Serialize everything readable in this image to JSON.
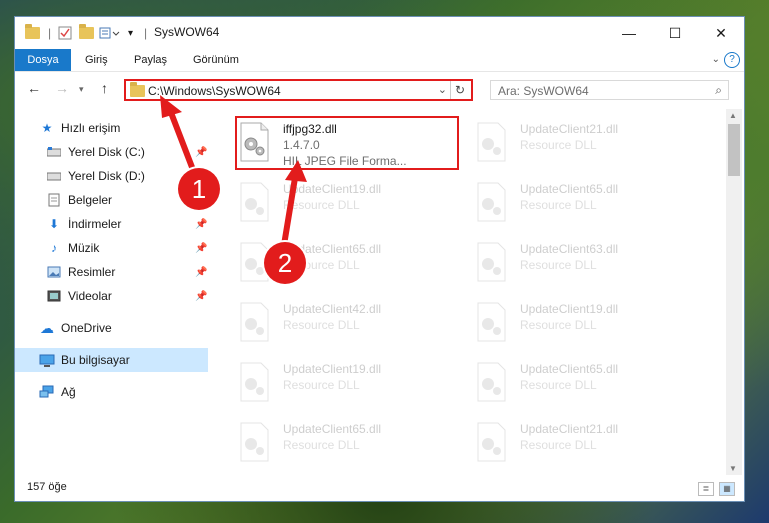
{
  "window": {
    "title": "SysWOW64"
  },
  "ribbon": {
    "tabs": [
      "Dosya",
      "Giriş",
      "Paylaş",
      "Görünüm"
    ]
  },
  "address": {
    "path": "C:\\Windows\\SysWOW64"
  },
  "search": {
    "placeholder": "Ara: SysWOW64"
  },
  "sidebar": {
    "items": [
      {
        "label": "Hızlı erişim",
        "icon": "star-icon"
      },
      {
        "label": "Yerel Disk (C:)",
        "icon": "drive-icon"
      },
      {
        "label": "Yerel Disk (D:)",
        "icon": "drive-icon"
      },
      {
        "label": "Belgeler",
        "icon": "documents-icon"
      },
      {
        "label": "İndirmeler",
        "icon": "download-icon"
      },
      {
        "label": "Müzik",
        "icon": "music-icon"
      },
      {
        "label": "Resimler",
        "icon": "pictures-icon"
      },
      {
        "label": "Videolar",
        "icon": "videos-icon"
      },
      {
        "label": "OneDrive",
        "icon": "cloud-icon"
      },
      {
        "label": "Bu bilgisayar",
        "icon": "computer-icon"
      },
      {
        "label": "Ağ",
        "icon": "network-icon"
      }
    ]
  },
  "files": {
    "highlighted": {
      "name": "iffjpg32.dll",
      "version": "1.4.7.0",
      "description": "HIL JPEG File Forma..."
    },
    "left_column": [
      {
        "name": "UpdateClient19.dll",
        "desc": "Resource DLL"
      },
      {
        "name": "UpdateClient65.dll",
        "desc": "Resource DLL"
      },
      {
        "name": "UpdateClient42.dll",
        "desc": "Resource DLL"
      },
      {
        "name": "UpdateClient19.dll",
        "desc": "Resource DLL"
      },
      {
        "name": "UpdateClient65.dll",
        "desc": "Resource DLL"
      }
    ],
    "right_column": [
      {
        "name": "UpdateClient21.dll",
        "desc": "Resource DLL"
      },
      {
        "name": "UpdateClient65.dll",
        "desc": "Resource DLL"
      },
      {
        "name": "UpdateClient63.dll",
        "desc": "Resource DLL"
      },
      {
        "name": "UpdateClient19.dll",
        "desc": "Resource DLL"
      },
      {
        "name": "UpdateClient65.dll",
        "desc": "Resource DLL"
      },
      {
        "name": "UpdateClient21.dll",
        "desc": "Resource DLL"
      }
    ]
  },
  "status": {
    "count": "157 öğe"
  },
  "annotations": {
    "step1": "1",
    "step2": "2",
    "color": "#e21c1c"
  }
}
